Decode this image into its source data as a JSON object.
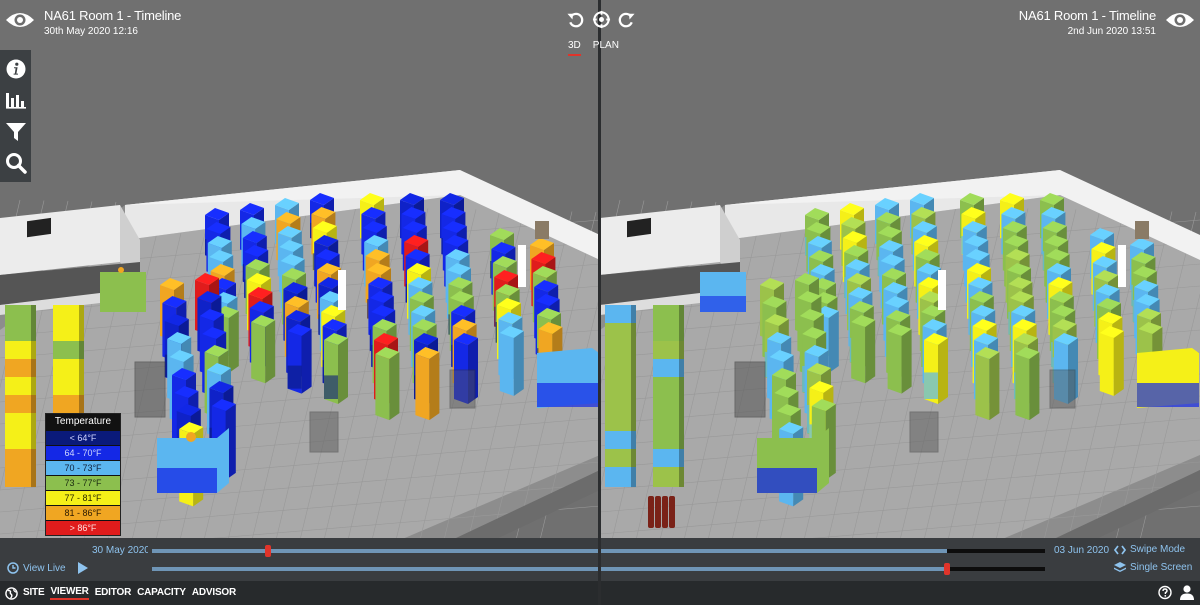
{
  "left_view": {
    "title": "NA61 Room 1 - Timeline",
    "timestamp": "30th May 2020 12:16",
    "eye_icon": "eye-icon"
  },
  "right_view": {
    "title": "NA61 Room 1 - Timeline",
    "timestamp": "2nd Jun 2020 13:51",
    "eye_icon": "eye-icon"
  },
  "center_controls": {
    "icons": [
      "rotate-left-icon",
      "recenter-icon",
      "rotate-right-icon"
    ],
    "tabs": [
      {
        "label": "3D",
        "active": true
      },
      {
        "label": "PLAN",
        "active": false
      }
    ]
  },
  "toolbar": {
    "items": [
      "info-icon",
      "chart-icon",
      "filter-icon",
      "search-icon"
    ]
  },
  "legend": {
    "title": "Temperature",
    "rows": [
      {
        "label": "< 64°F",
        "color": "#0a1a7a",
        "text_color": "#d0d4ff"
      },
      {
        "label": "64 - 70°F",
        "color": "#1428e6",
        "text_color": "#d0d8ff"
      },
      {
        "label": "70 - 73°F",
        "color": "#5bb6f0",
        "text_color": "#10203a"
      },
      {
        "label": "73 - 77°F",
        "color": "#8cbf4e",
        "text_color": "#1a2a10"
      },
      {
        "label": "77 - 81°F",
        "color": "#f5f018",
        "text_color": "#2a2a00"
      },
      {
        "label": "81 - 86°F",
        "color": "#f0a622",
        "text_color": "#2a1800"
      },
      {
        "label": "> 86°F",
        "color": "#e01c1c",
        "text_color": "#ffe0e0"
      }
    ]
  },
  "timeline": {
    "start_label": "30 May 2020",
    "end_label": "03 Jun 2020",
    "top_slider": {
      "value_fraction": 0.13,
      "fill_fraction": 0.89
    },
    "bottom_slider": {
      "value_fraction": 0.89,
      "fill_fraction": 0.89
    },
    "view_live_label": "View Live",
    "swipe_mode_label": "Swipe Mode",
    "single_screen_label": "Single Screen"
  },
  "navbar": {
    "items": [
      {
        "label": "SITE",
        "active": false
      },
      {
        "label": "VIEWER",
        "active": true
      },
      {
        "label": "EDITOR",
        "active": false
      },
      {
        "label": "CAPACITY",
        "active": false
      },
      {
        "label": "ADVISOR",
        "active": false
      }
    ],
    "right_icons": [
      "help-icon",
      "user-icon"
    ]
  },
  "scene": {
    "left_palette": [
      "#1428e6",
      "#1428e6",
      "#0f22c8",
      "#5bb6f0",
      "#8cbf4e",
      "#f5f018",
      "#f0a622",
      "#e01c1c",
      "#1428e6",
      "#5bb6f0"
    ],
    "right_palette": [
      "#8cbf4e",
      "#8cbf4e",
      "#5bb6f0",
      "#9cc24a",
      "#5bb6f0",
      "#f5f018",
      "#8cbf4e",
      "#5bb6f0"
    ]
  }
}
